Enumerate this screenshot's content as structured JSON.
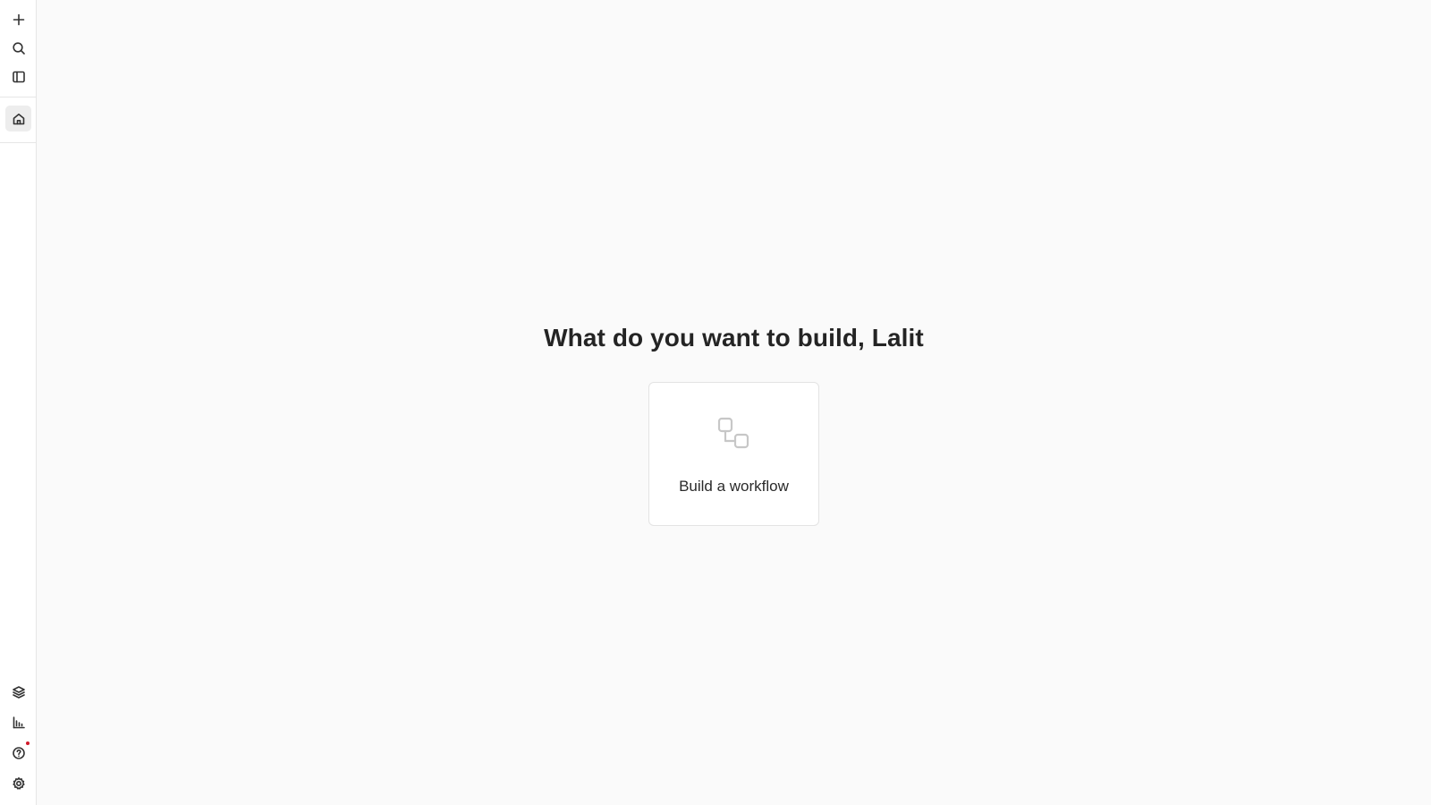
{
  "sidebar": {
    "top_items": [
      {
        "icon": "plus-icon",
        "action": "new"
      },
      {
        "icon": "search-icon",
        "action": "search"
      },
      {
        "icon": "panel-icon",
        "action": "toggle-sidebar"
      }
    ],
    "nav_items": [
      {
        "icon": "home-icon",
        "active": true
      }
    ],
    "bottom_items": [
      {
        "icon": "templates-icon"
      },
      {
        "icon": "chart-icon"
      },
      {
        "icon": "help-icon",
        "has_notification": true
      },
      {
        "icon": "gear-icon"
      }
    ],
    "notification_color": "#d11a2a"
  },
  "main": {
    "headline": "What do you want to build, Lalit",
    "cards": [
      {
        "label": "Build a workflow",
        "icon": "workflow-icon"
      }
    ]
  }
}
